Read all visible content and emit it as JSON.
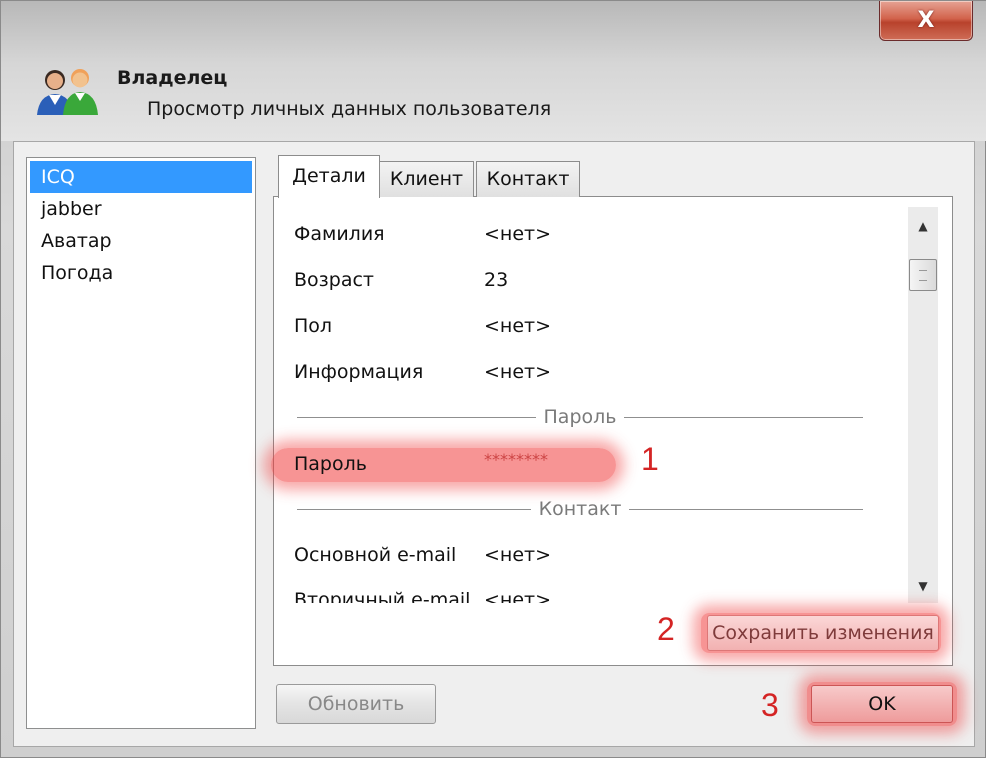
{
  "window": {
    "close_symbol": "X",
    "title": "Владелец",
    "subtitle": "Просмотр личных данных пользователя",
    "icon": "users-icon"
  },
  "sidebar": {
    "items": [
      {
        "label": "ICQ",
        "selected": true
      },
      {
        "label": "jabber",
        "selected": false
      },
      {
        "label": "Аватар",
        "selected": false
      },
      {
        "label": "Погода",
        "selected": false
      }
    ]
  },
  "tabs": [
    {
      "label": "Детали",
      "active": true
    },
    {
      "label": "Клиент",
      "active": false
    },
    {
      "label": "Контакт",
      "active": false
    }
  ],
  "details": {
    "rows": [
      {
        "label": "Фамилия",
        "value": "<нет>"
      },
      {
        "label": "Возраст",
        "value": "23"
      },
      {
        "label": "Пол",
        "value": "<нет>"
      },
      {
        "label": "Информация",
        "value": "<нет>"
      }
    ],
    "section_password": "Пароль",
    "password_row": {
      "label": "Пароль",
      "value": "********"
    },
    "section_contact": "Контакт",
    "contact_rows": [
      {
        "label": "Основной e-mail",
        "value": "<нет>"
      },
      {
        "label": "Вторичный e-mail",
        "value": "<нет>"
      }
    ]
  },
  "buttons": {
    "save_changes": "Сохранить изменения",
    "refresh": "Обновить",
    "ok": "OK"
  },
  "annotations": {
    "step1": "1",
    "step2": "2",
    "step3": "3",
    "highlight_color": "#e83c3c"
  }
}
